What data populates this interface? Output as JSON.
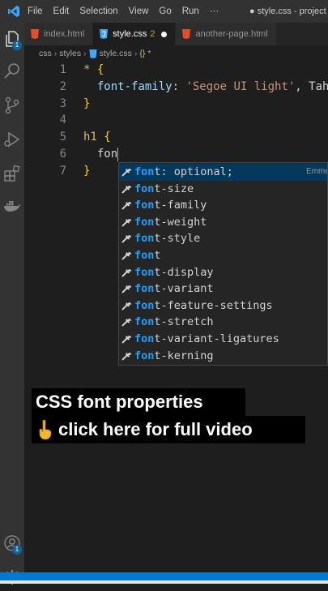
{
  "titlebar": {
    "menus": [
      "File",
      "Edit",
      "Selection",
      "View",
      "Go",
      "Run",
      "···"
    ],
    "window_title": "● style.css - project - V"
  },
  "activity": {
    "explorer_badge": "1",
    "accounts_badge": "1"
  },
  "tabs": [
    {
      "label": "index.html",
      "active": false
    },
    {
      "label": "style.css",
      "problems": "2",
      "active": true,
      "dirty": true
    },
    {
      "label": "another-page.html",
      "active": false
    }
  ],
  "breadcrumb": {
    "parts": [
      "css",
      "styles",
      "style.css"
    ],
    "symbol": "*"
  },
  "code_lines": [
    {
      "n": "1",
      "parts": [
        {
          "t": "* ",
          "c": "sel"
        },
        {
          "t": "{",
          "c": "brace"
        }
      ]
    },
    {
      "n": "2",
      "parts": [
        {
          "t": "  font-family",
          "c": "prop"
        },
        {
          "t": ": ",
          "c": "punct"
        },
        {
          "t": "'Segoe UI light'",
          "c": "str"
        },
        {
          "t": ", Tah",
          "c": "plain"
        }
      ]
    },
    {
      "n": "3",
      "parts": [
        {
          "t": "}",
          "c": "brace"
        }
      ]
    },
    {
      "n": "4",
      "parts": []
    },
    {
      "n": "5",
      "parts": [
        {
          "t": "h1 ",
          "c": "sel"
        },
        {
          "t": "{",
          "c": "brace"
        }
      ]
    },
    {
      "n": "6",
      "parts": [
        {
          "t": "  fon",
          "c": "plain"
        }
      ],
      "cursor": true
    },
    {
      "n": "7",
      "parts": [
        {
          "t": "}",
          "c": "brace"
        }
      ]
    }
  ],
  "suggestions": {
    "typed": "fon",
    "items": [
      {
        "match": "fon",
        "rest": "t: optional;",
        "detail": "Emme"
      },
      {
        "match": "fon",
        "rest": "t-size"
      },
      {
        "match": "fon",
        "rest": "t-family"
      },
      {
        "match": "fon",
        "rest": "t-weight"
      },
      {
        "match": "fon",
        "rest": "t-style"
      },
      {
        "match": "fon",
        "rest": "t"
      },
      {
        "match": "fon",
        "rest": "t-display"
      },
      {
        "match": "fon",
        "rest": "t-variant"
      },
      {
        "match": "fon",
        "rest": "t-feature-settings"
      },
      {
        "match": "fon",
        "rest": "t-stretch"
      },
      {
        "match": "fon",
        "rest": "t-variant-ligatures"
      },
      {
        "match": "fon",
        "rest": "t-kerning"
      }
    ]
  },
  "caption": {
    "line1": "CSS font properties",
    "line2": "click here for full video"
  },
  "colors": {
    "accent": "#007acc",
    "match": "#18a3ff",
    "selected_row": "#04395e"
  }
}
